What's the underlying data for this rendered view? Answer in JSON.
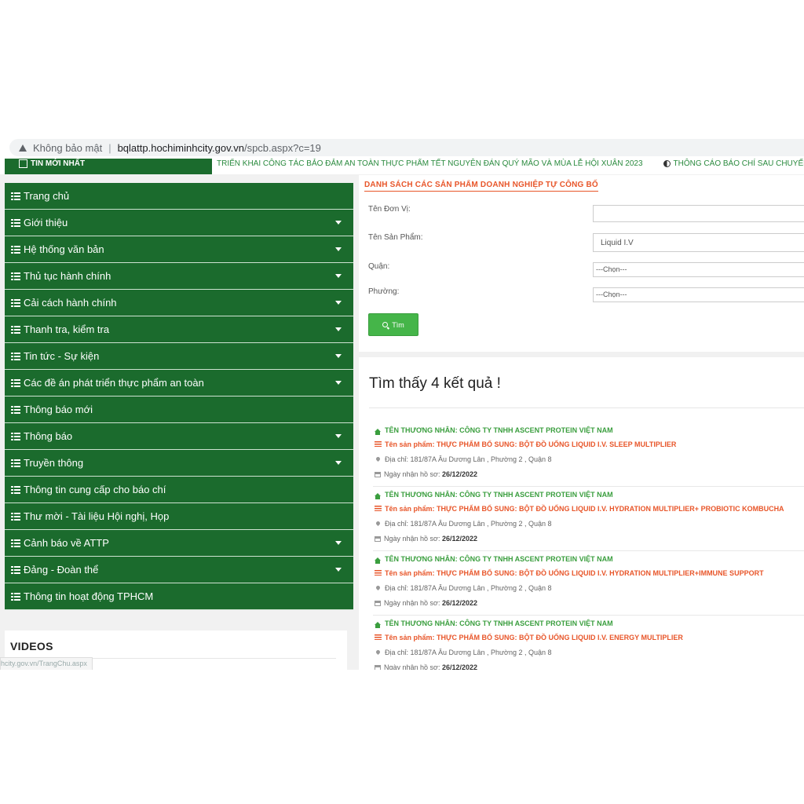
{
  "browser": {
    "security_label": "Không bảo mật",
    "url_host": "bqlattp.hochiminhcity.gov.vn",
    "url_path": "/spcb.aspx?c=19"
  },
  "ticker": {
    "label": "TIN MỚI NHẤT",
    "item1": "TRIỂN KHAI CÔNG TÁC BẢO ĐẢM AN TOÀN THỰC PHẨM TẾT NGUYÊN ĐÁN QUÝ MÃO VÀ MÙA LỄ HỘI XUÂN 2023",
    "item2": "THÔNG CÁO BÁO CHÍ SAU CHUYẾN CÔNG T"
  },
  "sidebar": {
    "items": [
      {
        "label": "Trang chủ"
      },
      {
        "label": "Giới thiệu"
      },
      {
        "label": "Hệ thống văn bản"
      },
      {
        "label": "Thủ tục hành chính"
      },
      {
        "label": "Cải cách hành chính"
      },
      {
        "label": "Thanh tra, kiểm tra"
      },
      {
        "label": "Tin tức - Sự kiện"
      },
      {
        "label": "Các đề án phát triển thực phẩm an toàn"
      },
      {
        "label": "Thông báo mới"
      },
      {
        "label": "Thông báo"
      },
      {
        "label": "Truyền thông"
      },
      {
        "label": "Thông tin cung cấp cho báo chí"
      },
      {
        "label": "Thư mời - Tài liệu Hội nghị, Họp"
      },
      {
        "label": "Cảnh báo về ATTP"
      },
      {
        "label": "Đảng - Đoàn thể"
      },
      {
        "label": "Thông tin hoạt động TPHCM"
      }
    ],
    "videos_title": "VIDEOS"
  },
  "status_url": "hcity.gov.vn/TrangChu.aspx",
  "form": {
    "title": "DANH SÁCH CÁC SẢN PHẨM DOANH NGHIỆP TỰ CÔNG BỐ",
    "unit_label": "Tên Đơn Vị:",
    "unit_value": "",
    "product_label": "Tên Sản Phẩm:",
    "product_value": "Liquid I.V",
    "district_label": "Quận:",
    "district_value": "---Chọn---",
    "ward_label": "Phường:",
    "ward_value": "---Chọn---",
    "search_button": "Tìm"
  },
  "results": {
    "heading": "Tìm thấy 4 kết quả !",
    "items": [
      {
        "company": "TÊN THƯƠNG NHÂN: CÔNG TY TNHH ASCENT PROTEIN VIỆT NAM",
        "product": "Tên sản phẩm: THỰC PHẨM BỔ SUNG: BỘT ĐỒ UỐNG LIQUID I.V. SLEEP MULTIPLIER",
        "address": "Địa chỉ: 181/87A Âu Dương Lân , Phường 2 , Quận 8",
        "date_label": "Ngày nhận hồ sơ:",
        "date": "26/12/2022"
      },
      {
        "company": "TÊN THƯƠNG NHÂN: CÔNG TY TNHH ASCENT PROTEIN VIỆT NAM",
        "product": "Tên sản phẩm: THỰC PHẨM BỔ SUNG: BỘT ĐỒ UỐNG LIQUID I.V. HYDRATION MULTIPLIER+ PROBIOTIC KOMBUCHA",
        "address": "Địa chỉ: 181/87A Âu Dương Lân , Phường 2 , Quận 8",
        "date_label": "Ngày nhận hồ sơ:",
        "date": "26/12/2022"
      },
      {
        "company": "TÊN THƯƠNG NHÂN: CÔNG TY TNHH ASCENT PROTEIN VIỆT NAM",
        "product": "Tên sản phẩm: THỰC PHẨM BỔ SUNG: BỘT ĐỒ UỐNG LIQUID I.V. HYDRATION MULTIPLIER+IMMUNE SUPPORT",
        "address": "Địa chỉ: 181/87A Âu Dương Lân , Phường 2 , Quận 8",
        "date_label": "Ngày nhận hồ sơ:",
        "date": "26/12/2022"
      },
      {
        "company": "TÊN THƯƠNG NHÂN: CÔNG TY TNHH ASCENT PROTEIN VIỆT NAM",
        "product": "Tên sản phẩm: THỰC PHẨM BỔ SUNG: BỘT ĐỒ UỐNG LIQUID I.V. ENERGY MULTIPLIER",
        "address": "Địa chỉ: 181/87A Âu Dương Lân , Phường 2 , Quận 8",
        "date_label": "Ngày nhận hồ sơ:",
        "date": "26/12/2022"
      }
    ]
  },
  "colors": {
    "menu_green": "#1b6b2d",
    "accent_orange": "#e8562a",
    "company_green": "#3a9e3e",
    "button_green": "#45b549"
  }
}
